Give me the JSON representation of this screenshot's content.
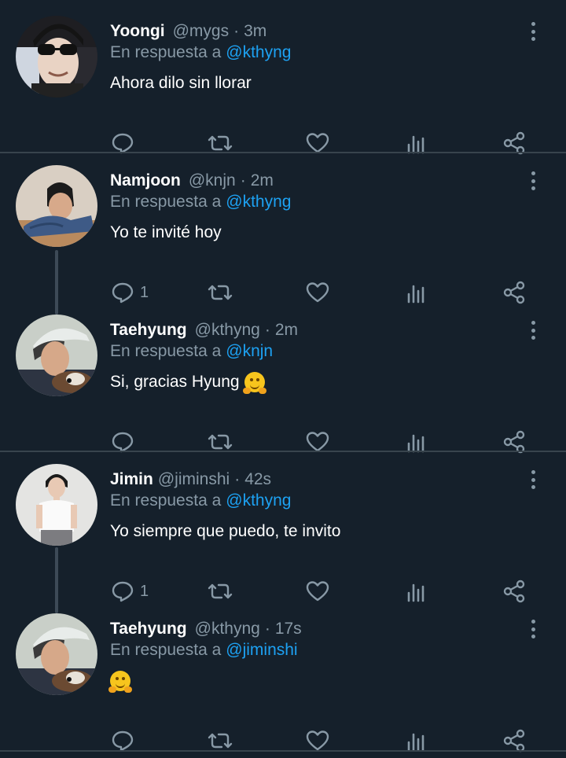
{
  "reply_prefix": "En respuesta a",
  "tweets": [
    {
      "name": "Yoongi",
      "handle": "@mygs",
      "time": "3m",
      "reply_to": "@kthyng",
      "text": "Ahora dilo sin llorar",
      "reply_count": "",
      "emoji": false
    },
    {
      "name": "Namjoon",
      "handle": "@knjn",
      "time": "2m",
      "reply_to": "@kthyng",
      "text": "Yo te invité hoy",
      "reply_count": "1",
      "emoji": false
    },
    {
      "name": "Taehyung",
      "handle": "@kthyng",
      "time": "2m",
      "reply_to": "@knjn",
      "text": "Si, gracias Hyung",
      "reply_count": "",
      "emoji": true
    },
    {
      "name": "Jimin",
      "handle": "@jiminshi",
      "time": "42s",
      "reply_to": "@kthyng",
      "text": "Yo siempre que puedo, te invito",
      "reply_count": "1",
      "emoji": false
    },
    {
      "name": "Taehyung",
      "handle": "@kthyng",
      "time": "17s",
      "reply_to": "@jiminshi",
      "text": "",
      "reply_count": "",
      "emoji": true
    }
  ],
  "icons": [
    "comment-icon",
    "retweet-icon",
    "like-icon",
    "analytics-icon",
    "share-icon",
    "more-options-icon"
  ],
  "colors": {
    "background": "#15202b",
    "mention": "#1da1f2",
    "secondary_text": "#8899a6",
    "separator": "#38444d"
  }
}
